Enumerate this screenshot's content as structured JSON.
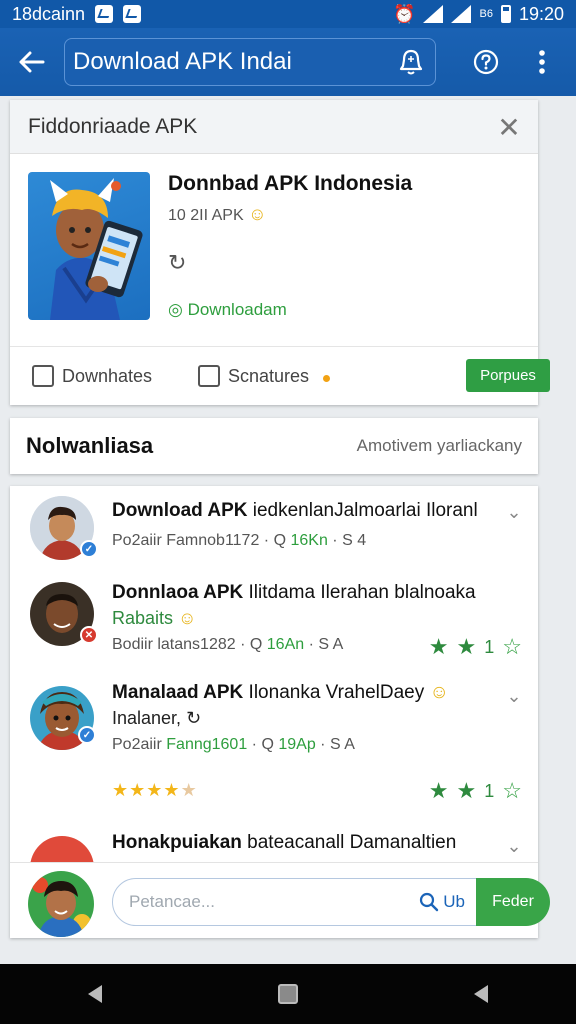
{
  "status_bar": {
    "left_text": "18dcainn",
    "right_small": "B6",
    "time": "19:20"
  },
  "app_bar": {
    "search_text": "Download APK Indai"
  },
  "app_card": {
    "header_title": "Fiddonriaade APK",
    "app_name": "Donnbad APK Indonesia",
    "meta": "10 2II APK",
    "download_link": "Downloadam",
    "tabs": [
      {
        "label": "Downhates"
      },
      {
        "label": "Scnatures"
      }
    ],
    "action_button": "Porpues"
  },
  "section": {
    "title": "Nolwanliasa",
    "action": "Amotivem yarliackany"
  },
  "reviews": [
    {
      "title_bold": "Download APK",
      "title_rest": " iedkenlanJalmoarlai Iloranl",
      "meta_a": "Po2aiir Famnob1172",
      "meta_b": "Q",
      "meta_c": "16Kn",
      "meta_d": "S",
      "meta_e": "4"
    },
    {
      "title_bold": "Donnlaoa APK",
      "title_rest": " Ilitdama Ilerahan blalnoaka",
      "subtitle": "Rabaits",
      "meta_a": "Bodiir latans1282",
      "meta_b": "Q",
      "meta_c": "16An",
      "meta_d": "S",
      "meta_e": "A",
      "stars_count": "1"
    },
    {
      "title_bold": "Manalaad APK",
      "title_rest": " Ilonanka VrahelDaey",
      "subtitle": "Inalaner,",
      "meta_a": "Po2aiir",
      "meta_a_green": "Fanng1601",
      "meta_b": "Q",
      "meta_c": "19Ap",
      "meta_d": "S",
      "meta_e": "A",
      "stars_count": "1"
    },
    {
      "title_bold": "Honakpuiakan",
      "title_rest": " bateaсanall Damanaltien"
    }
  ],
  "composer": {
    "placeholder": "Petancae...",
    "search_label": "Ub",
    "send_label": "Feder"
  },
  "colors": {
    "primary_blue": "#1a62b4",
    "green": "#2f9e44",
    "star_yellow": "#f3b619"
  },
  "icons": [
    "back-arrow-icon",
    "bell-icon",
    "help-icon",
    "more-vert-icon",
    "close-icon",
    "refresh-icon",
    "whatsapp-icon",
    "checkbox-icon",
    "chevron-down-icon",
    "star-icon",
    "search-icon",
    "nav-back-icon",
    "nav-home-icon",
    "nav-recents-icon"
  ]
}
